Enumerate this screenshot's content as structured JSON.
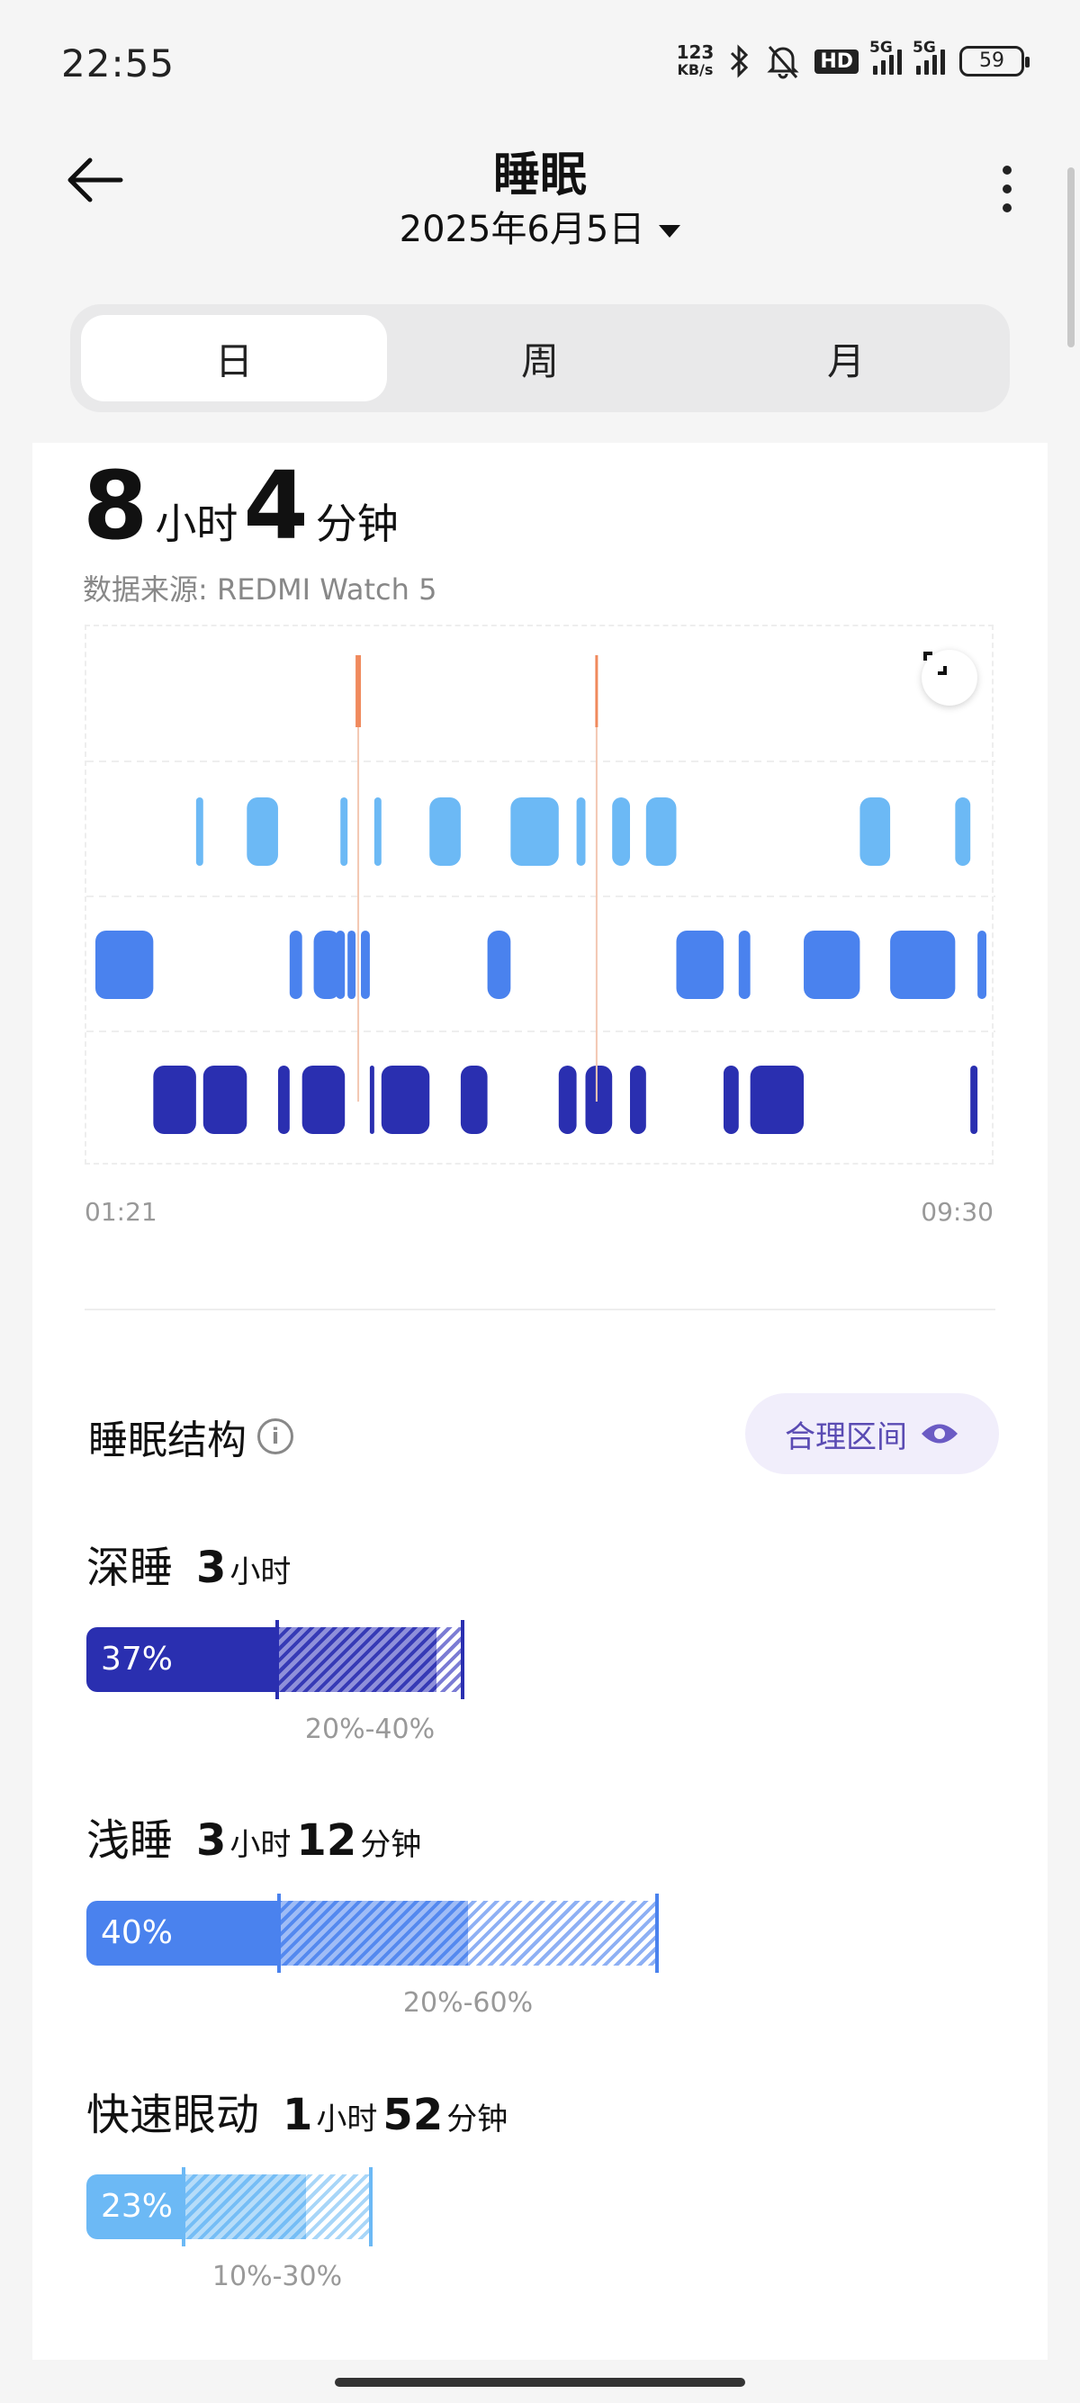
{
  "status_bar": {
    "time": "22:55",
    "net_speed_value": "123",
    "net_speed_unit": "KB/s",
    "hd_label": "HD",
    "signal_1_label": "5G",
    "signal_2_label": "5G",
    "battery": "59",
    "icons": [
      "bluetooth-icon",
      "silent-bell-icon",
      "hd-icon",
      "signal-5g-icon",
      "signal-5g-icon",
      "battery-icon"
    ]
  },
  "header": {
    "title": "睡眠",
    "date": "2025年6月5日",
    "icons": [
      "back-arrow-icon",
      "caret-down-icon",
      "more-vertical-icon"
    ]
  },
  "tabs": [
    {
      "label": "日",
      "active": true
    },
    {
      "label": "周",
      "active": false
    },
    {
      "label": "月",
      "active": false
    }
  ],
  "summary": {
    "hours": "8",
    "hours_unit": "小时",
    "minutes": "4",
    "minutes_unit": "分钟",
    "source": "数据来源: REDMI Watch 5"
  },
  "chart_data": {
    "type": "area",
    "start_time": "01:21",
    "end_time": "09:30",
    "levels": [
      "awake",
      "rem",
      "light",
      "deep"
    ],
    "colors": {
      "awake": "#f08a5d",
      "rem": "#6cb9f5",
      "light": "#4a82ee",
      "deep": "#2a2fb0"
    },
    "segments": [
      {
        "stage": "light",
        "t0": 0.0,
        "t1": 0.065
      },
      {
        "stage": "deep",
        "t0": 0.065,
        "t1": 0.113
      },
      {
        "stage": "rem",
        "t0": 0.113,
        "t1": 0.121
      },
      {
        "stage": "deep",
        "t0": 0.121,
        "t1": 0.17
      },
      {
        "stage": "rem",
        "t0": 0.17,
        "t1": 0.205
      },
      {
        "stage": "deep",
        "t0": 0.205,
        "t1": 0.218
      },
      {
        "stage": "light",
        "t0": 0.218,
        "t1": 0.232
      },
      {
        "stage": "deep",
        "t0": 0.232,
        "t1": 0.28
      },
      {
        "stage": "light",
        "t0": 0.28,
        "t1": 0.27
      },
      {
        "stage": "light",
        "t0": 0.245,
        "t1": 0.275
      },
      {
        "stage": "rem",
        "t0": 0.275,
        "t1": 0.283
      },
      {
        "stage": "light",
        "t0": 0.283,
        "t1": 0.292
      },
      {
        "stage": "awake",
        "t0": 0.292,
        "t1": 0.298
      },
      {
        "stage": "light",
        "t0": 0.298,
        "t1": 0.308
      },
      {
        "stage": "deep",
        "t0": 0.308,
        "t1": 0.313
      },
      {
        "stage": "rem",
        "t0": 0.313,
        "t1": 0.321
      },
      {
        "stage": "deep",
        "t0": 0.321,
        "t1": 0.375
      },
      {
        "stage": "rem",
        "t0": 0.375,
        "t1": 0.41
      },
      {
        "stage": "deep",
        "t0": 0.41,
        "t1": 0.44
      },
      {
        "stage": "light",
        "t0": 0.44,
        "t1": 0.466
      },
      {
        "stage": "rem",
        "t0": 0.466,
        "t1": 0.52
      },
      {
        "stage": "deep",
        "t0": 0.52,
        "t1": 0.54
      },
      {
        "stage": "rem",
        "t0": 0.54,
        "t1": 0.55
      },
      {
        "stage": "deep",
        "t0": 0.55,
        "t1": 0.58
      },
      {
        "stage": "awake",
        "t0": 0.561,
        "t1": 0.564
      },
      {
        "stage": "rem",
        "t0": 0.58,
        "t1": 0.6
      },
      {
        "stage": "deep",
        "t0": 0.6,
        "t1": 0.618
      },
      {
        "stage": "rem",
        "t0": 0.618,
        "t1": 0.652
      },
      {
        "stage": "light",
        "t0": 0.652,
        "t1": 0.705
      },
      {
        "stage": "deep",
        "t0": 0.705,
        "t1": 0.722
      },
      {
        "stage": "light",
        "t0": 0.722,
        "t1": 0.735
      },
      {
        "stage": "deep",
        "t0": 0.735,
        "t1": 0.795
      },
      {
        "stage": "light",
        "t0": 0.795,
        "t1": 0.858
      },
      {
        "stage": "rem",
        "t0": 0.858,
        "t1": 0.892
      },
      {
        "stage": "light",
        "t0": 0.892,
        "t1": 0.965
      },
      {
        "stage": "rem",
        "t0": 0.965,
        "t1": 0.982
      },
      {
        "stage": "deep",
        "t0": 0.982,
        "t1": 0.99
      },
      {
        "stage": "light",
        "t0": 0.99,
        "t1": 1.0
      }
    ]
  },
  "structure": {
    "title": "睡眠结构",
    "range_button": "合理区间",
    "stages": [
      {
        "name": "深睡",
        "hours": "3",
        "hours_unit": "小时",
        "minutes": "",
        "minutes_unit": "",
        "percent_label": "37%",
        "percent": 37,
        "range_label": "20%-40%",
        "range_min": 20,
        "range_max": 40,
        "color": "#2a2fb0",
        "hatch_color": "#7b7cd4"
      },
      {
        "name": "浅睡",
        "hours": "3",
        "hours_unit": "小时",
        "minutes": "12",
        "minutes_unit": "分钟",
        "percent_label": "40%",
        "percent": 40,
        "range_label": "20%-60%",
        "range_min": 20,
        "range_max": 60,
        "color": "#4a82ee",
        "hatch_color": "#8eb0f4"
      },
      {
        "name": "快速眼动",
        "hours": "1",
        "hours_unit": "小时",
        "minutes": "52",
        "minutes_unit": "分钟",
        "percent_label": "23%",
        "percent": 23,
        "range_label": "10%-30%",
        "range_min": 10,
        "range_max": 30,
        "color": "#6cb9f5",
        "hatch_color": "#a8d6f8"
      }
    ]
  }
}
